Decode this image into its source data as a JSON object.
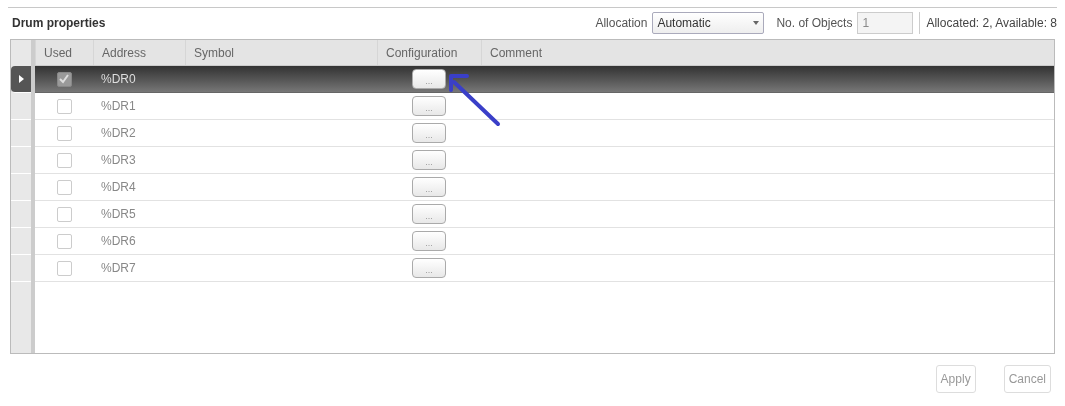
{
  "panel": {
    "title": "Drum properties"
  },
  "toolbar": {
    "allocation_label": "Allocation",
    "allocation_value": "Automatic",
    "objects_label": "No. of Objects",
    "objects_value": "1",
    "objects_disabled": true,
    "status": "Allocated: 2, Available: 8"
  },
  "table": {
    "columns": [
      "Used",
      "Address",
      "Symbol",
      "Configuration",
      "Comment"
    ],
    "rows": [
      {
        "selected": true,
        "checked": true,
        "address": "%DR0",
        "config": "..."
      },
      {
        "selected": false,
        "checked": false,
        "address": "%DR1",
        "config": "..."
      },
      {
        "selected": false,
        "checked": false,
        "address": "%DR2",
        "config": "..."
      },
      {
        "selected": false,
        "checked": false,
        "address": "%DR3",
        "config": "..."
      },
      {
        "selected": false,
        "checked": false,
        "address": "%DR4",
        "config": "..."
      },
      {
        "selected": false,
        "checked": false,
        "address": "%DR5",
        "config": "..."
      },
      {
        "selected": false,
        "checked": false,
        "address": "%DR6",
        "config": "..."
      },
      {
        "selected": false,
        "checked": false,
        "address": "%DR7",
        "config": "..."
      }
    ]
  },
  "buttons": [
    {
      "label": "Apply",
      "disabled": true
    },
    {
      "label": "Cancel",
      "disabled": true
    }
  ]
}
